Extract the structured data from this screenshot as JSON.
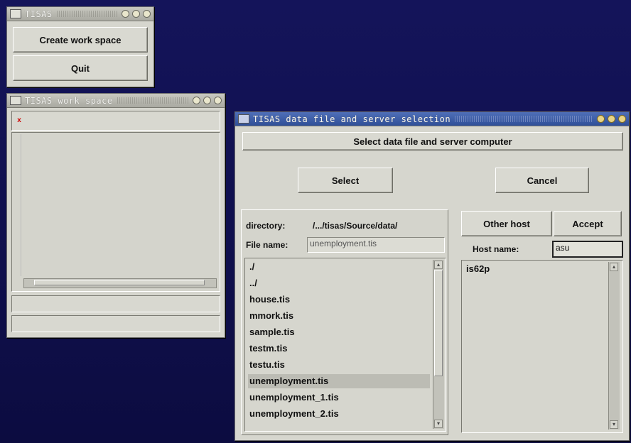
{
  "main_window": {
    "title": "TISAS",
    "create_label": "Create work space",
    "quit_label": "Quit"
  },
  "workspace_window": {
    "title": "TISAS work space",
    "tab_marker": "x"
  },
  "dialog": {
    "title": "TISAS data file and server selection",
    "heading": "Select data file and server computer",
    "select_label": "Select",
    "cancel_label": "Cancel",
    "directory_label": "directory:",
    "directory_value": "/.../tisas/Source/data/",
    "filename_label": "File name:",
    "filename_value": "unemployment.tis",
    "files": [
      "./",
      "../",
      "house.tis",
      "mmork.tis",
      "sample.tis",
      "testm.tis",
      "testu.tis",
      "unemployment.tis",
      "unemployment_1.tis",
      "unemployment_2.tis"
    ],
    "selected_file": "unemployment.tis",
    "other_host_label": "Other host",
    "accept_label": "Accept",
    "host_label": "Host name:",
    "host_value": "asu",
    "hosts": [
      "is62p"
    ]
  },
  "colors": {
    "desktop": "#10104c",
    "window": "#d6d6ce",
    "active_title": "#3a5aa8"
  }
}
